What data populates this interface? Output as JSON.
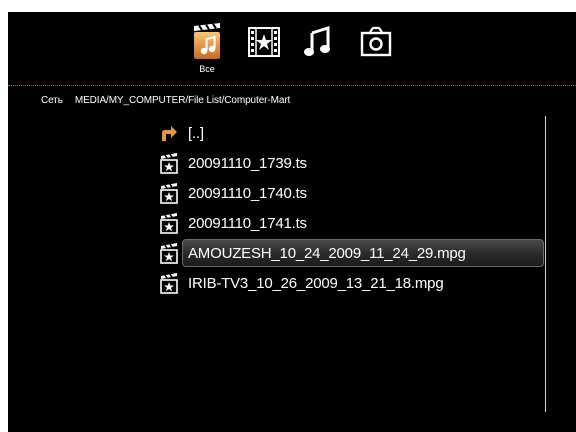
{
  "tabs": [
    {
      "id": "all",
      "label": "Все",
      "icon": "film-music-icon",
      "active": true
    },
    {
      "id": "video",
      "label": "",
      "icon": "film-star-icon",
      "active": false
    },
    {
      "id": "music",
      "label": "",
      "icon": "music-note-icon",
      "active": false
    },
    {
      "id": "photo",
      "label": "",
      "icon": "camera-icon",
      "active": false
    }
  ],
  "breadcrumb": {
    "network_label": "Сеть",
    "path": "MEDIA/MY_COMPUTER/File List/Computer-Mart"
  },
  "files": [
    {
      "name": "[..]",
      "icon": "folder-up-icon",
      "selected": false
    },
    {
      "name": "20091110_1739.ts",
      "icon": "video-file-icon",
      "selected": false
    },
    {
      "name": "20091110_1740.ts",
      "icon": "video-file-icon",
      "selected": false
    },
    {
      "name": "20091110_1741.ts",
      "icon": "video-file-icon",
      "selected": false
    },
    {
      "name": "AMOUZESH_10_24_2009_11_24_29.mpg",
      "icon": "video-file-icon",
      "selected": true
    },
    {
      "name": "IRIB-TV3_10_26_2009_13_21_18.mpg",
      "icon": "video-file-icon",
      "selected": false
    }
  ],
  "colors": {
    "background": "#000000",
    "accent_orange": "#e09a3a",
    "separator": "#b5542a",
    "text": "#ffffff"
  }
}
